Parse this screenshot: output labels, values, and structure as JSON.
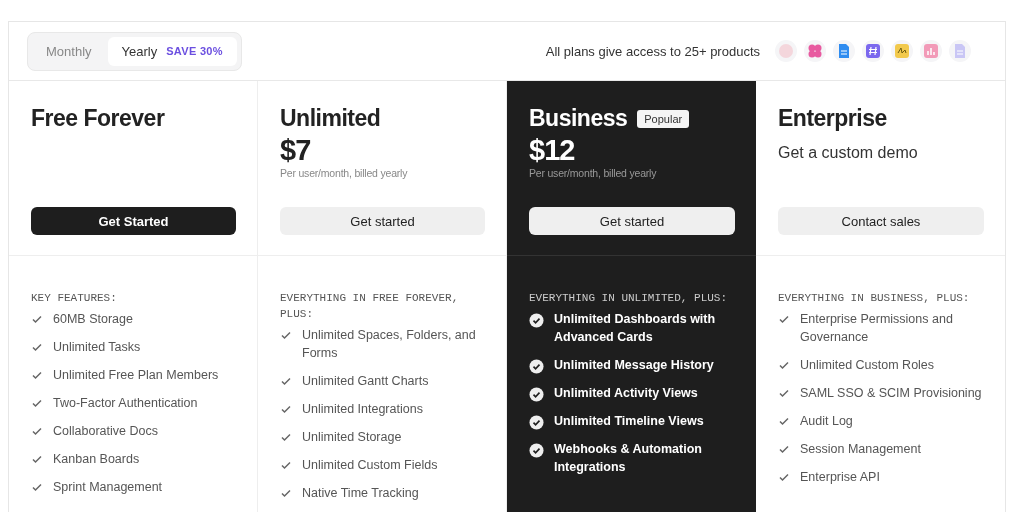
{
  "billing_toggle": [
    {
      "label": "Monthly",
      "selected": false
    },
    {
      "label": "Yearly",
      "selected": true,
      "badge": "SAVE 30%"
    }
  ],
  "products_note": "All plans give access to 25+ products",
  "product_icons": [
    {
      "kind": "avatar",
      "color": "#f4d6dc"
    },
    {
      "kind": "flower",
      "color": "#e85aa0"
    },
    {
      "kind": "doc",
      "color": "#2f8cf0"
    },
    {
      "kind": "hash",
      "color": "#7b68ee"
    },
    {
      "kind": "scribble",
      "color": "#f2c94c"
    },
    {
      "kind": "chart",
      "color": "#f29ab8"
    },
    {
      "kind": "doc",
      "color": "#c9c6f5"
    }
  ],
  "plans": [
    {
      "name": "Free Forever",
      "highlighted": false,
      "button": {
        "label": "Get Started",
        "primary": true
      },
      "features_heading": "KEY FEATURES:",
      "features": [
        "60MB Storage",
        "Unlimited Tasks",
        "Unlimited Free Plan Members",
        "Two-Factor Authentication",
        "Collaborative Docs",
        "Kanban Boards",
        "Sprint Management"
      ]
    },
    {
      "name": "Unlimited",
      "highlighted": false,
      "price": "$7",
      "price_note": "Per user/month, billed yearly",
      "button": {
        "label": "Get started",
        "primary": false
      },
      "features_heading": "EVERYTHING IN FREE FOREVER, PLUS:",
      "features": [
        "Unlimited Spaces, Folders, and Forms",
        "Unlimited Gantt Charts",
        "Unlimited Integrations",
        "Unlimited Storage",
        "Unlimited Custom Fields",
        "Native Time Tracking"
      ]
    },
    {
      "name": "Business",
      "highlighted": true,
      "badge": "Popular",
      "price": "$12",
      "price_note": "Per user/month, billed yearly",
      "button": {
        "label": "Get started",
        "primary": false
      },
      "features_heading": "EVERYTHING IN UNLIMITED, PLUS:",
      "features": [
        "Unlimited Dashboards with Advanced Cards",
        "Unlimited Message History",
        "Unlimited Activity Views",
        "Unlimited Timeline Views",
        "Webhooks & Automation Integrations"
      ]
    },
    {
      "name": "Enterprise",
      "highlighted": false,
      "subtitle": "Get a custom demo",
      "button": {
        "label": "Contact sales",
        "primary": false
      },
      "features_heading": "EVERYTHING IN BUSINESS, PLUS:",
      "features": [
        "Enterprise Permissions and Governance",
        "Unlimited Custom Roles",
        "SAML SSO & SCIM Provisioning",
        "Audit Log",
        "Session Management",
        "Enterprise API"
      ]
    }
  ]
}
